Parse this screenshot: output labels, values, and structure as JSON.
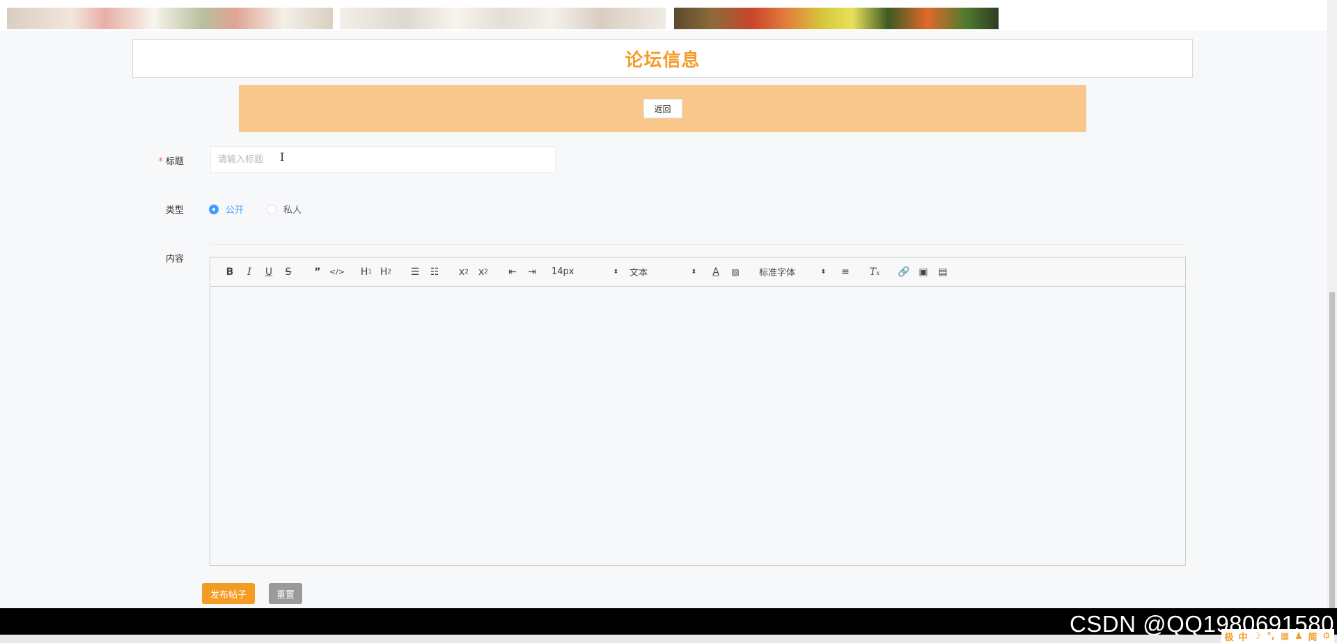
{
  "header": {
    "title": "论坛信息",
    "back_label": "返回"
  },
  "form": {
    "title_label": "标题",
    "title_placeholder": "请输入标题",
    "title_value": "",
    "type_label": "类型",
    "type_options": [
      {
        "label": "公开",
        "selected": true
      },
      {
        "label": "私人",
        "selected": false
      }
    ],
    "content_label": "内容"
  },
  "editor": {
    "font_size": "14px",
    "header_select": "文本",
    "font_family": "标准字体",
    "toolbar_icons": [
      "bold-icon",
      "italic-icon",
      "underline-icon",
      "strike-icon",
      "blockquote-icon",
      "code-block-icon",
      "h1-icon",
      "h2-icon",
      "ordered-list-icon",
      "bullet-list-icon",
      "subscript-icon",
      "superscript-icon",
      "outdent-icon",
      "indent-icon",
      "font-color-icon",
      "background-color-icon",
      "align-icon",
      "clean-format-icon",
      "link-icon",
      "image-icon",
      "video-icon"
    ]
  },
  "actions": {
    "publish_label": "发布帖子",
    "reset_label": "重置"
  },
  "watermark": "CSDN @QQ1980691580",
  "ime": [
    "极",
    "中",
    "☽",
    "°,",
    "▦",
    "♟",
    "简",
    "⚙"
  ],
  "colors": {
    "accent": "#f39c2b",
    "bar": "#f9c68c",
    "radio": "#409eff"
  }
}
